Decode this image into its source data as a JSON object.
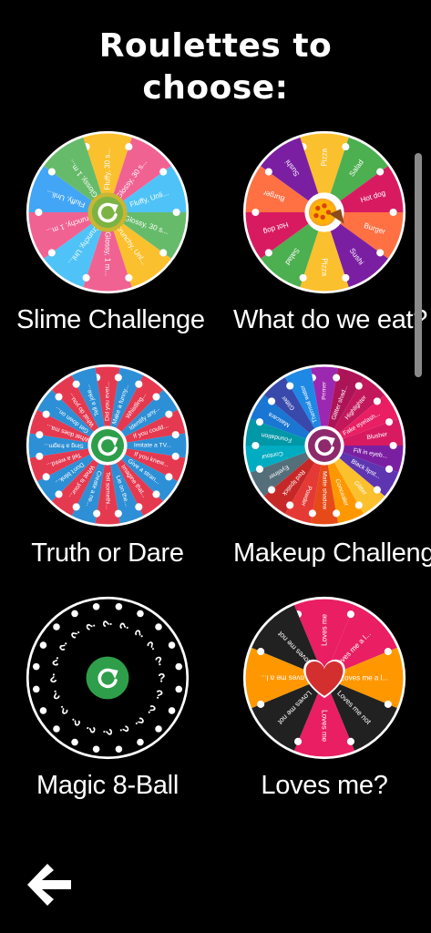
{
  "header": {
    "title_line1": "Roulettes to",
    "title_line2": "choose:"
  },
  "wheels": [
    {
      "label": "Slime Challenge",
      "hub": "refresh",
      "hub_color": "#7cb342",
      "segments": [
        {
          "text": "Fluffy, 30 s...",
          "color": "#fbc02d"
        },
        {
          "text": "Glossy, 30 s...",
          "color": "#f06292"
        },
        {
          "text": "Fluffy, Unli...",
          "color": "#4fc3f7"
        },
        {
          "text": "Glossy, 30 s...",
          "color": "#66bb6a"
        },
        {
          "text": "Crunchy, Unl...",
          "color": "#fbc02d"
        },
        {
          "text": "Glossy, 1 m...",
          "color": "#f06292"
        },
        {
          "text": "Crunchy, Unl...",
          "color": "#4fc3f7"
        },
        {
          "text": "Crunchy, 1 m...",
          "color": "#f06292"
        },
        {
          "text": "Fluffy, Unli...",
          "color": "#42a5f5"
        },
        {
          "text": "Glossy, 1 m...",
          "color": "#66bb6a"
        }
      ]
    },
    {
      "label": "What do we eat?",
      "hub": "pizza",
      "hub_color": "#ffffff",
      "segments": [
        {
          "text": "Pizza",
          "color": "#fbc02d"
        },
        {
          "text": "Salad",
          "color": "#4caf50"
        },
        {
          "text": "Hot dog",
          "color": "#d81b60"
        },
        {
          "text": "Burger",
          "color": "#ff7043"
        },
        {
          "text": "Sushi",
          "color": "#7b1fa2"
        },
        {
          "text": "Pizza",
          "color": "#fbc02d"
        },
        {
          "text": "Salad",
          "color": "#4caf50"
        },
        {
          "text": "Hot dog",
          "color": "#d81b60"
        },
        {
          "text": "Burger",
          "color": "#ff7043"
        },
        {
          "text": "Sushi",
          "color": "#7b1fa2"
        }
      ]
    },
    {
      "label": "Truth or Dare",
      "hub": "refresh",
      "hub_color": "#2e9e4a",
      "segments": [
        {
          "text": "Did you ever...",
          "color": "#e53950"
        },
        {
          "text": "Make a funny...",
          "color": "#2d8fd5"
        },
        {
          "text": "Whistling...",
          "color": "#e53950"
        },
        {
          "text": "Identify any...",
          "color": "#2d8fd5"
        },
        {
          "text": "If you could...",
          "color": "#e53950"
        },
        {
          "text": "Imitate a TV...",
          "color": "#2d8fd5"
        },
        {
          "text": "If you knew...",
          "color": "#e53950"
        },
        {
          "text": "Give a stran...",
          "color": "#2d8fd5"
        },
        {
          "text": "Imagine that...",
          "color": "#e53950"
        },
        {
          "text": "Lie on the...",
          "color": "#2d8fd5"
        },
        {
          "text": "Tell somethi...",
          "color": "#e53950"
        },
        {
          "text": "Create a ne...",
          "color": "#2d8fd5"
        },
        {
          "text": "What is your...",
          "color": "#e53950"
        },
        {
          "text": "Don't blink...",
          "color": "#2d8fd5"
        },
        {
          "text": "Tell a weird...",
          "color": "#e53950"
        },
        {
          "text": "Sing a fragm...",
          "color": "#2d8fd5"
        },
        {
          "text": "What does ma...",
          "color": "#e53950"
        },
        {
          "text": "Get down on...",
          "color": "#2d8fd5"
        },
        {
          "text": "What do you...",
          "color": "#e53950"
        },
        {
          "text": "Tell a joke...",
          "color": "#2d8fd5"
        }
      ]
    },
    {
      "label": "Makeup Challenge",
      "hub": "refresh",
      "hub_color": "#8e2a6b",
      "segments": [
        {
          "text": "Primer",
          "color": "#9c27b0"
        },
        {
          "text": "Glitter shad...",
          "color": "#ad1457"
        },
        {
          "text": "Highlighter",
          "color": "#c2185b"
        },
        {
          "text": "Fake eyelash...",
          "color": "#e91e63"
        },
        {
          "text": "Blusher",
          "color": "#d81b60"
        },
        {
          "text": "Fill in eyeb...",
          "color": "#7b1fa2"
        },
        {
          "text": "Black lipst...",
          "color": "#5e35b1"
        },
        {
          "text": "Glitter",
          "color": "#fbc02d"
        },
        {
          "text": "Concealer",
          "color": "#ff9800"
        },
        {
          "text": "Matte shadow",
          "color": "#e64a19"
        },
        {
          "text": "Powder",
          "color": "#e53935"
        },
        {
          "text": "Red lipstick",
          "color": "#c62828"
        },
        {
          "text": "Eyeliner",
          "color": "#546e7a"
        },
        {
          "text": "Contour",
          "color": "#00acc1"
        },
        {
          "text": "Foundation",
          "color": "#0097a7"
        },
        {
          "text": "Mascara",
          "color": "#1976d2"
        },
        {
          "text": "Glitter",
          "color": "#3949ab"
        },
        {
          "text": "Thermal water",
          "color": "#1e88e5"
        }
      ]
    },
    {
      "label": "Magic 8-Ball",
      "hub": "refresh",
      "hub_color": "#2e9e4a",
      "segments": [
        {
          "text": "?",
          "color": "#000000"
        },
        {
          "text": "?",
          "color": "#000000"
        },
        {
          "text": "?",
          "color": "#000000"
        },
        {
          "text": "?",
          "color": "#000000"
        },
        {
          "text": "?",
          "color": "#000000"
        },
        {
          "text": "?",
          "color": "#000000"
        },
        {
          "text": "?",
          "color": "#000000"
        },
        {
          "text": "?",
          "color": "#000000"
        },
        {
          "text": "?",
          "color": "#000000"
        },
        {
          "text": "?",
          "color": "#000000"
        },
        {
          "text": "?",
          "color": "#000000"
        },
        {
          "text": "?",
          "color": "#000000"
        },
        {
          "text": "?",
          "color": "#000000"
        },
        {
          "text": "?",
          "color": "#000000"
        },
        {
          "text": "?",
          "color": "#000000"
        },
        {
          "text": "?",
          "color": "#000000"
        },
        {
          "text": "?",
          "color": "#000000"
        },
        {
          "text": "?",
          "color": "#000000"
        },
        {
          "text": "?",
          "color": "#000000"
        },
        {
          "text": "?",
          "color": "#000000"
        }
      ]
    },
    {
      "label": "Loves me?",
      "hub": "heart",
      "hub_color": "#d32f2f",
      "segments": [
        {
          "text": "Loves me",
          "color": "#e91e63"
        },
        {
          "text": "Loves me a l...",
          "color": "#e91e63"
        },
        {
          "text": "Loves me a l...",
          "color": "#ff9800"
        },
        {
          "text": "Loves me not",
          "color": "#212121"
        },
        {
          "text": "Loves me",
          "color": "#e91e63"
        },
        {
          "text": "Loves me not",
          "color": "#212121"
        },
        {
          "text": "Loves me a l...",
          "color": "#ff9800"
        },
        {
          "text": "Loves me not",
          "color": "#212121"
        }
      ]
    }
  ],
  "nav": {
    "back_icon": "arrow-left-icon"
  }
}
